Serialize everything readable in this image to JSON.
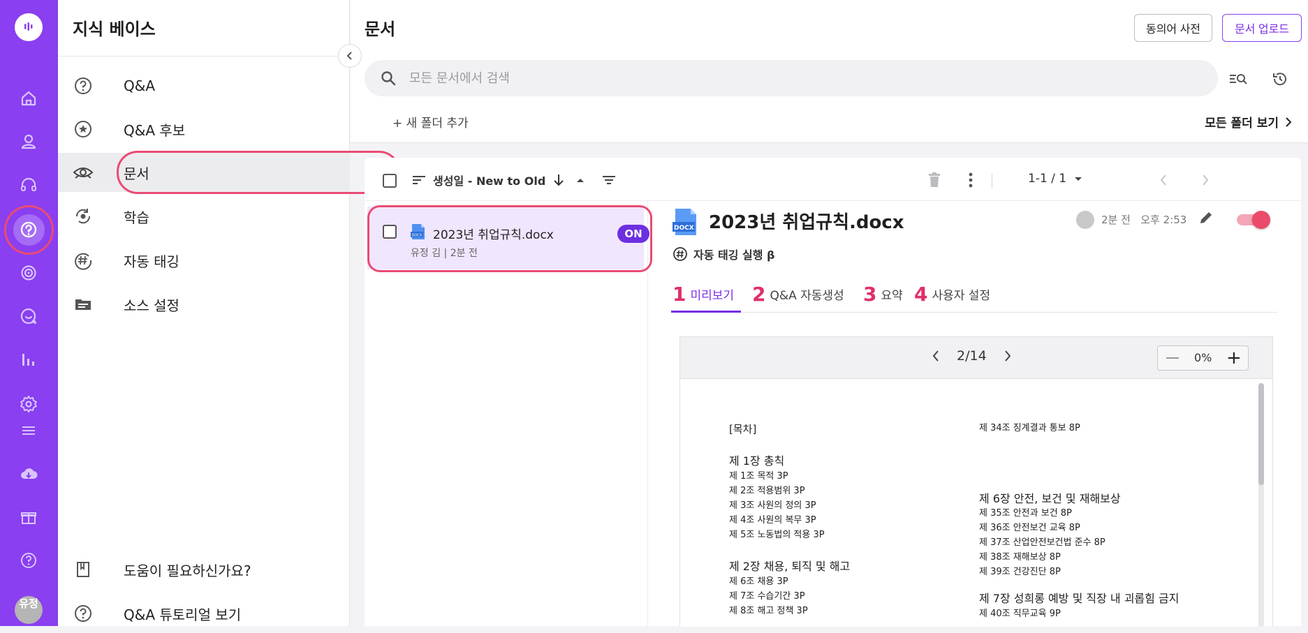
{
  "sidebar": {
    "title": "지식 베이스",
    "items": [
      {
        "label": "Q&A"
      },
      {
        "label": "Q&A 후보"
      },
      {
        "label": "문서"
      },
      {
        "label": "학습"
      },
      {
        "label": "자동 태깅"
      },
      {
        "label": "소스 설정"
      }
    ],
    "help": "도움이 필요하신가요?",
    "tutorial": "Q&A 튜토리얼 보기"
  },
  "rail": {
    "avatar_text": "유정"
  },
  "header": {
    "title": "문서",
    "synonym_button": "동의어 사전",
    "upload_button": "문서 업로드",
    "search_placeholder": "모든 문서에서 검색",
    "new_folder": "+ 새 폴더 추가",
    "all_folders": "모든 폴더 보기"
  },
  "toolbar": {
    "sort_label": "생성일 - New to Old",
    "pager": "1-1 / 1"
  },
  "list": {
    "items": [
      {
        "name": "2023년 취업규칙.docx",
        "meta": "유정 김 | 2분 전",
        "badge": "ON"
      }
    ]
  },
  "detail": {
    "title": "2023년 취업규칙.docx",
    "time_rel": "2분 전",
    "time_abs": "오후 2:53",
    "autotag": "자동 태깅 실행 β",
    "enabled": true,
    "tabs": [
      {
        "num": "1",
        "label": "미리보기"
      },
      {
        "num": "2",
        "label": "Q&A 자동생성"
      },
      {
        "num": "3",
        "label": "요약"
      },
      {
        "num": "4",
        "label": "사용자 설정"
      }
    ]
  },
  "viewer": {
    "page": "2/14",
    "zoom": "0%",
    "left_col": [
      "[목차]",
      "제 1장 총칙",
      "제 1조 목적 3P",
      "제 2조 적용범위 3P",
      "제 3조 사원의 정의 3P",
      "제 4조 사원의 복무 3P",
      "제 5조 노동법의 적용 3P",
      "제 2장 채용, 퇴직 및 해고",
      "제 6조 채용 3P",
      "제 7조 수습기간 3P",
      "제 8조 해고 정책 3P"
    ],
    "right_col": [
      "제 34조 징계결과 통보 8P",
      "제 6장 안전, 보건 및 재해보상",
      "제 35조 안전과 보건 8P",
      "제 36조 안전보건 교육 8P",
      "제 37조 산업안전보건법 준수 8P",
      "제 38조 재해보상 8P",
      "제 39조 건강진단 8P",
      "제 7장 성희롱 예방 및 직장 내 괴롭힘 금지",
      "제 40조 직무교육 9P"
    ]
  },
  "colors": {
    "brand": "#8a3ff0",
    "highlight": "#e94b74",
    "badge": "#6c2fe0"
  }
}
